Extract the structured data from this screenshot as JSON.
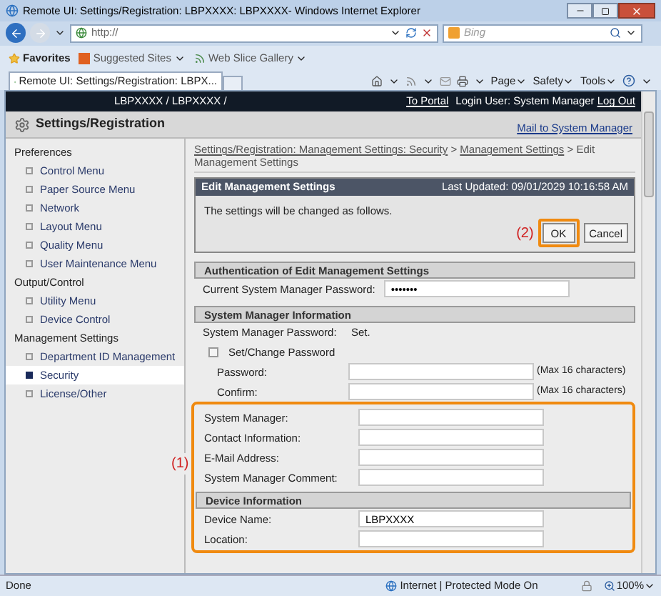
{
  "window": {
    "title": "Remote UI: Settings/Registration: LBPXXXX: LBPXXXX- Windows Internet Explorer"
  },
  "address_bar": {
    "value": "http://"
  },
  "search": {
    "placeholder": "Bing"
  },
  "favorites_bar": {
    "favorites": "Favorites",
    "items": [
      "Suggested Sites",
      "Web Slice Gallery"
    ]
  },
  "tab": {
    "title": "Remote UI: Settings/Registration: LBPX..."
  },
  "command_bar": [
    "Page",
    "Safety",
    "Tools"
  ],
  "header": {
    "device_path": "LBPXXXX / LBPXXXX /",
    "portal": "To Portal",
    "login_user": "Login User: System Manager",
    "logout": "Log Out",
    "heading": "Settings/Registration",
    "mail_link": "Mail to System Manager"
  },
  "sidebar": {
    "groups": [
      {
        "title": "Preferences",
        "items": [
          {
            "label": "Control Menu",
            "selected": false
          },
          {
            "label": "Paper Source Menu",
            "selected": false
          },
          {
            "label": "Network",
            "selected": false
          },
          {
            "label": "Layout Menu",
            "selected": false
          },
          {
            "label": "Quality Menu",
            "selected": false
          },
          {
            "label": "User Maintenance Menu",
            "selected": false
          }
        ]
      },
      {
        "title": "Output/Control",
        "items": [
          {
            "label": "Utility Menu",
            "selected": false
          },
          {
            "label": "Device Control",
            "selected": false
          }
        ]
      },
      {
        "title": "Management Settings",
        "items": [
          {
            "label": "Department ID Management",
            "selected": false
          },
          {
            "label": "Security",
            "selected": true
          },
          {
            "label": "License/Other",
            "selected": false
          }
        ]
      }
    ]
  },
  "breadcrumb": [
    {
      "label": "Settings/Registration: Management Settings: Security",
      "link": true
    },
    {
      "label": ">",
      "link": false
    },
    {
      "label": "Management Settings",
      "link": true
    },
    {
      "label": "> Edit Management Settings",
      "link": false
    }
  ],
  "panel": {
    "title": "Edit Management Settings",
    "last_updated": "Last Updated: 09/01/2029 10:16:58 AM",
    "message": "The settings will be changed as follows.",
    "callout": "(2)",
    "ok": "OK",
    "cancel": "Cancel"
  },
  "auth_section": {
    "title": "Authentication of Edit Management Settings",
    "rows": [
      {
        "kind": "field",
        "label": "Current System Manager Password:",
        "value": "•••••••"
      }
    ]
  },
  "manager_section": {
    "title": "System Manager Information",
    "rows": [
      {
        "kind": "text",
        "label": "System Manager Password:",
        "value": "Set."
      },
      {
        "kind": "checkbox",
        "label": "Set/Change Password",
        "checked": false
      },
      {
        "kind": "subfield",
        "label": "Password:",
        "hint": "(Max 16 characters)"
      },
      {
        "kind": "subfield",
        "label": "Confirm:",
        "hint": "(Max 16 characters)"
      }
    ]
  },
  "highlighted": {
    "callout": "(1)",
    "rows": [
      {
        "kind": "wide",
        "label": "System Manager:"
      },
      {
        "kind": "wide",
        "label": "Contact Information:"
      },
      {
        "kind": "wide",
        "label": "E-Mail Address:"
      },
      {
        "kind": "wide",
        "label": "System Manager Comment:"
      }
    ],
    "section": {
      "title": "Device Information",
      "rows": [
        {
          "kind": "wide",
          "label": "Device Name:",
          "value": "LBPXXXX"
        },
        {
          "kind": "wide",
          "label": "Location:"
        }
      ]
    }
  },
  "status_bar": {
    "status": "Done",
    "zone": "Internet | Protected Mode On",
    "zoom": "100%"
  }
}
